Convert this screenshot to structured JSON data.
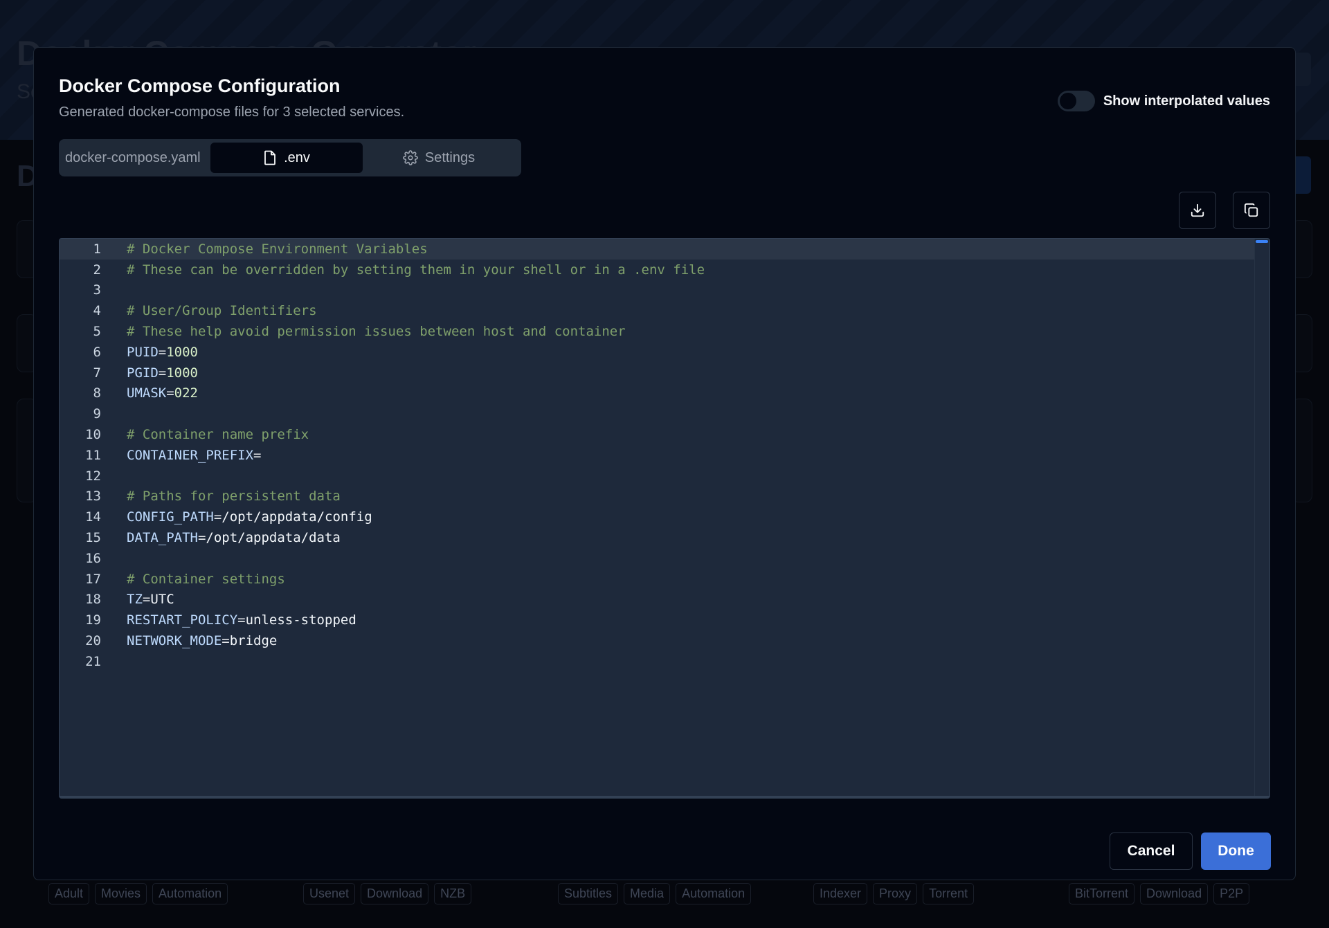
{
  "background": {
    "title": "Docker Compose Generator",
    "subtitle": "Se",
    "section_letter": "D",
    "tag_groups": [
      [
        "Adult",
        "Movies",
        "Automation"
      ],
      [
        "Usenet",
        "Download",
        "NZB"
      ],
      [
        "Subtitles",
        "Media",
        "Automation"
      ],
      [
        "Indexer",
        "Proxy",
        "Torrent"
      ],
      [
        "BitTorrent",
        "Download",
        "P2P"
      ]
    ]
  },
  "modal": {
    "title": "Docker Compose Configuration",
    "description": "Generated docker-compose files for 3 selected services.",
    "toggle_label": "Show interpolated values",
    "toggle_on": false,
    "tabs": {
      "compose": "docker-compose.yaml",
      "env": ".env",
      "settings": "Settings",
      "active": "env"
    },
    "editor_lines": [
      {
        "n": "1",
        "type": "comment",
        "text": "# Docker Compose Environment Variables"
      },
      {
        "n": "2",
        "type": "comment",
        "text": "# These can be overridden by setting them in your shell or in a .env file"
      },
      {
        "n": "3",
        "type": "blank",
        "text": ""
      },
      {
        "n": "4",
        "type": "comment",
        "text": "# User/Group Identifiers"
      },
      {
        "n": "5",
        "type": "comment",
        "text": "# These help avoid permission issues between host and container"
      },
      {
        "n": "6",
        "type": "kv",
        "key": "PUID",
        "value": "1000",
        "numeric": true
      },
      {
        "n": "7",
        "type": "kv",
        "key": "PGID",
        "value": "1000",
        "numeric": true
      },
      {
        "n": "8",
        "type": "kv",
        "key": "UMASK",
        "value": "022",
        "numeric": true
      },
      {
        "n": "9",
        "type": "blank",
        "text": ""
      },
      {
        "n": "10",
        "type": "comment",
        "text": "# Container name prefix"
      },
      {
        "n": "11",
        "type": "kv",
        "key": "CONTAINER_PREFIX",
        "value": "",
        "numeric": false
      },
      {
        "n": "12",
        "type": "blank",
        "text": ""
      },
      {
        "n": "13",
        "type": "comment",
        "text": "# Paths for persistent data"
      },
      {
        "n": "14",
        "type": "kv",
        "key": "CONFIG_PATH",
        "value": "/opt/appdata/config",
        "numeric": false
      },
      {
        "n": "15",
        "type": "kv",
        "key": "DATA_PATH",
        "value": "/opt/appdata/data",
        "numeric": false
      },
      {
        "n": "16",
        "type": "blank",
        "text": ""
      },
      {
        "n": "17",
        "type": "comment",
        "text": "# Container settings"
      },
      {
        "n": "18",
        "type": "kv",
        "key": "TZ",
        "value": "UTC",
        "numeric": false
      },
      {
        "n": "19",
        "type": "kv",
        "key": "RESTART_POLICY",
        "value": "unless-stopped",
        "numeric": false
      },
      {
        "n": "20",
        "type": "kv",
        "key": "NETWORK_MODE",
        "value": "bridge",
        "numeric": false
      },
      {
        "n": "21",
        "type": "blank",
        "text": ""
      }
    ],
    "buttons": {
      "cancel": "Cancel",
      "done": "Done"
    },
    "icons": {
      "download": "download-icon",
      "copy": "copy-icon"
    },
    "colors": {
      "accent": "#3b6fd8",
      "comment": "#7fa06b",
      "key": "#bfdbfe"
    }
  }
}
